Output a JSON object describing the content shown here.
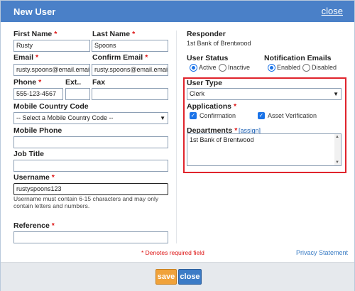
{
  "dialog": {
    "title": "New User",
    "close_link": "close"
  },
  "form": {
    "first_name": {
      "label": "First Name",
      "required": "*",
      "value": "Rusty"
    },
    "last_name": {
      "label": "Last Name",
      "required": "*",
      "value": "Spoons"
    },
    "email": {
      "label": "Email",
      "required": "*",
      "value": "rusty.spoons@email.email"
    },
    "confirm_email": {
      "label": "Confirm Email",
      "required": "*",
      "value": "rusty.spoons@email.email"
    },
    "phone": {
      "label": "Phone",
      "required": "*",
      "value": "555-123-4567"
    },
    "ext": {
      "label": "Ext..",
      "value": ""
    },
    "fax": {
      "label": "Fax",
      "value": ""
    },
    "mobile_country_code": {
      "label": "Mobile Country Code",
      "value": "-- Select a Mobile Country Code --"
    },
    "mobile_phone": {
      "label": "Mobile Phone",
      "value": ""
    },
    "job_title": {
      "label": "Job Title",
      "value": ""
    },
    "username": {
      "label": "Username",
      "required": "*",
      "value": "rustyspoons123",
      "hint_line1": "Username must contain 6-15 characters and may only",
      "hint_line2": "contain letters and numbers."
    },
    "reference": {
      "label": "Reference",
      "required": "*",
      "value": ""
    }
  },
  "right": {
    "responder": {
      "label": "Responder",
      "value": "1st Bank of Brentwood"
    },
    "user_status": {
      "label": "User Status",
      "options": [
        "Active",
        "Inactive"
      ],
      "selected": "Active"
    },
    "notification_emails": {
      "label": "Notification Emails",
      "options": [
        "Enabled",
        "Disabled"
      ],
      "selected": "Enabled"
    },
    "user_type": {
      "label": "User Type",
      "value": "Clerk"
    },
    "applications": {
      "label": "Applications",
      "required": "*",
      "items": [
        "Confirmation",
        "Asset Verification"
      ]
    },
    "departments": {
      "label": "Departments",
      "required": "*",
      "assign_link": "[assign]",
      "value": "1st Bank of Brentwood"
    }
  },
  "footer": {
    "required_note": "* Denotes required field",
    "privacy_link": "Privacy Statement",
    "save_label": "save",
    "close_label": "close"
  },
  "colors": {
    "titlebar": "#4a80c8",
    "highlight_border": "#e0242c",
    "save_button": "#f0a23a",
    "close_button": "#3b7bc6"
  }
}
